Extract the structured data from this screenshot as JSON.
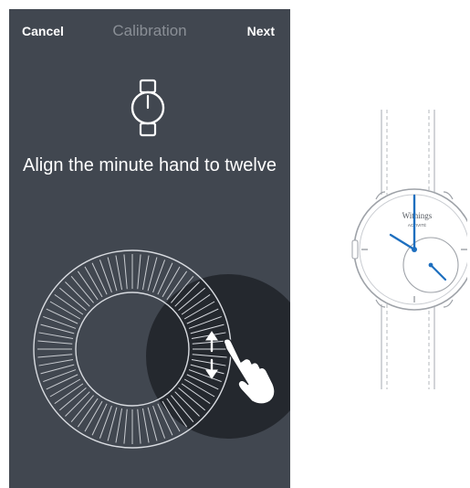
{
  "nav": {
    "cancel_label": "Cancel",
    "title": "Calibration",
    "next_label": "Next"
  },
  "main": {
    "instruction": "Align the minute hand to twelve"
  },
  "watch_illustration": {
    "brand": "Withings",
    "model": "ACTIVITÉ"
  },
  "colors": {
    "background": "#414750",
    "hand_accent": "#1e6fbf",
    "dial_lines": "#d8dbe0",
    "touch_circle": "#22262c"
  },
  "icons": {
    "watch": "watch-icon",
    "swipe_gesture": "swipe-vertical-icon",
    "hand": "hand-pointer-icon"
  }
}
